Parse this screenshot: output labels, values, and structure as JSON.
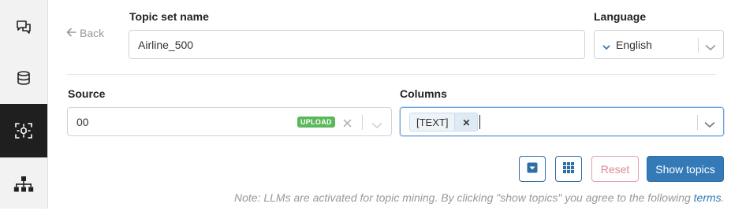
{
  "sidebar": {
    "items": [
      {
        "icon": "chat-bubbles-icon",
        "active": false
      },
      {
        "icon": "database-icon",
        "active": false
      },
      {
        "icon": "topic-clusters-icon",
        "active": true
      },
      {
        "icon": "hierarchy-icon",
        "active": false
      }
    ]
  },
  "back_label": "Back",
  "topic_set": {
    "label": "Topic set name",
    "value": "Airline_500"
  },
  "language": {
    "label": "Language",
    "value": "English"
  },
  "source": {
    "label": "Source",
    "value": "00",
    "badge": "UPLOAD"
  },
  "columns": {
    "label": "Columns",
    "tags": [
      "[TEXT]"
    ]
  },
  "buttons": {
    "reset": "Reset",
    "show_topics": "Show topics"
  },
  "note": {
    "text": "Note: LLMs are activated for topic mining. By clicking \"show topics\" you agree to the following ",
    "link": "terms",
    "end": "."
  },
  "colors": {
    "primary": "#337ab7",
    "upload_badge": "#5cb85c",
    "reset": "#e08a94",
    "sidebar_active": "#1f1f1f"
  }
}
